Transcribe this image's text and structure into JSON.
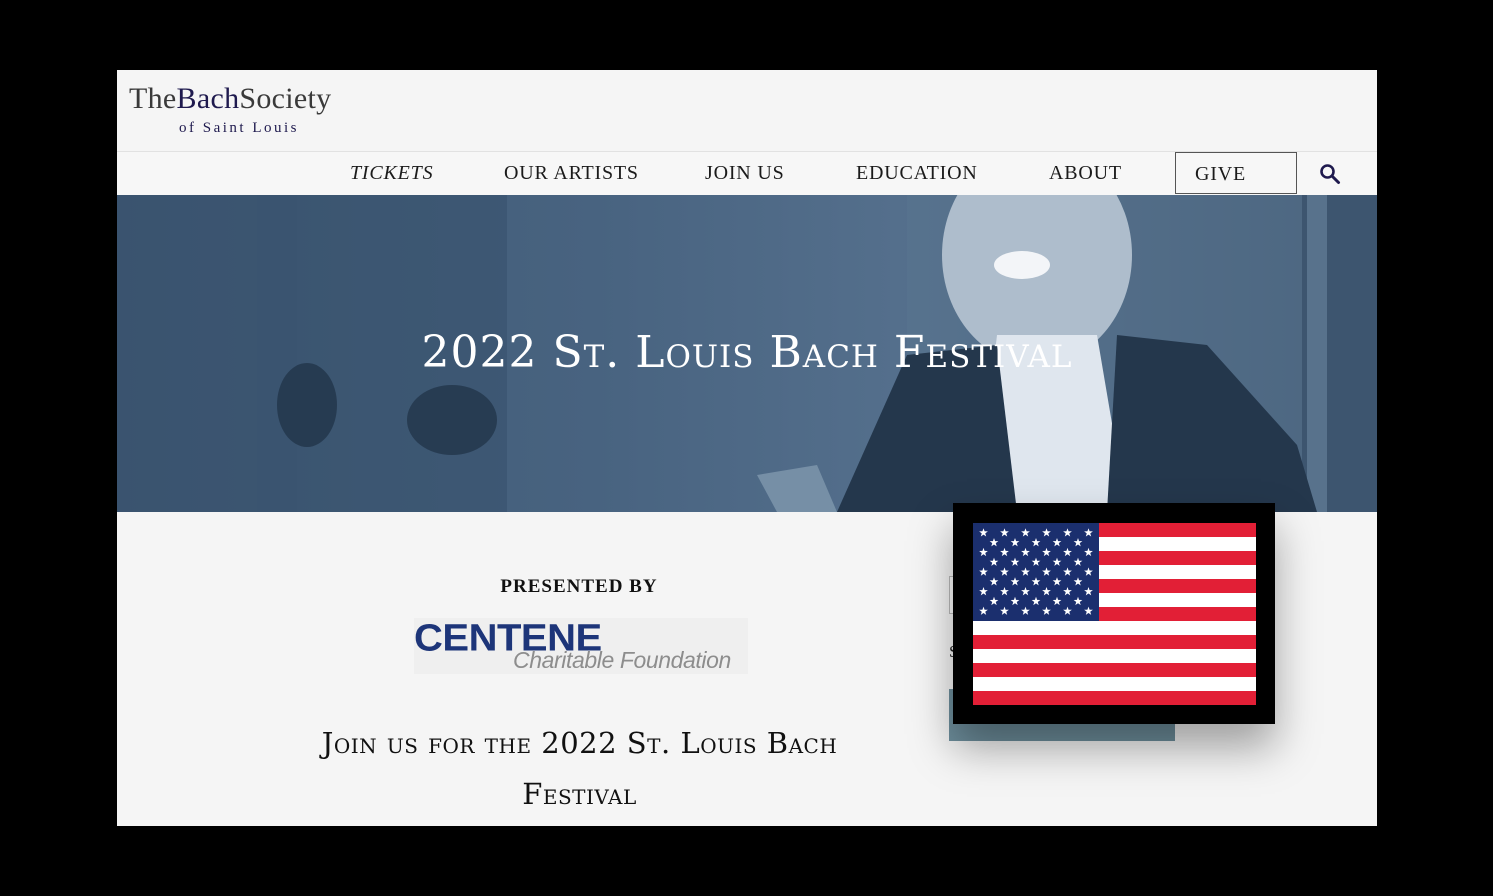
{
  "header": {
    "logo": {
      "top_the": "The",
      "top_bach": "Bach",
      "top_society": "Society",
      "subtitle": "of Saint Louis"
    }
  },
  "nav": {
    "items": [
      {
        "label": "TICKETS"
      },
      {
        "label": "OUR ARTISTS"
      },
      {
        "label": "JOIN US"
      },
      {
        "label": "EDUCATION"
      },
      {
        "label": "ABOUT"
      }
    ],
    "give_label": "GIVE",
    "search_icon": "search-icon"
  },
  "hero": {
    "title": "2022 St. Louis Bach Festival"
  },
  "main": {
    "presented_by": "PRESENTED BY",
    "sponsor": {
      "name": "CENTENE",
      "tagline": "Charitable Foundation"
    },
    "heading": "Join us for the 2022 St. Louis Bach Festival"
  },
  "sidebar": {
    "partial_letter": "S"
  },
  "overlay": {
    "icon": "us-flag-icon"
  },
  "colors": {
    "brand_navy": "#1f1a4e",
    "hero_blue": "#486380",
    "centene_blue": "#1d3579",
    "flag_red": "#e21f36",
    "flag_blue": "#1b2f6e"
  }
}
